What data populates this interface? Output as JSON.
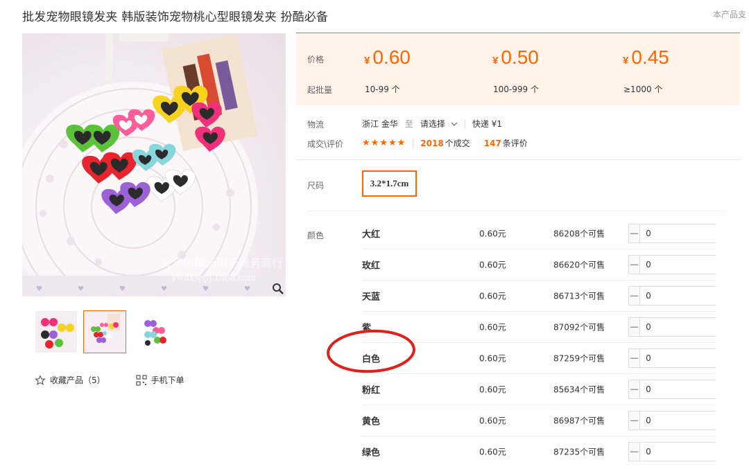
{
  "product": {
    "title": "批发宠物眼镜发夹 韩版装饰宠物桃心型眼镜发夹 扮酷必备",
    "report_link": "本产品支"
  },
  "gallery": {
    "watermark_line1": "义乌市酷玩电子商务商行",
    "watermark_line2": "ywdxsppj.1688.com",
    "zoom_icon": "magnifier-icon",
    "thumbnails": [
      "thumb-1",
      "thumb-2",
      "thumb-3"
    ],
    "active_thumbnail": 1
  },
  "actions": {
    "favorite_label": "收藏产品（5）",
    "favorite_icon": "star-outline-icon",
    "mobile_label": "手机下单",
    "mobile_icon": "qrcode-icon"
  },
  "pricing": {
    "price_label": "价格",
    "moq_label": "起批量",
    "currency": "¥",
    "tiers": [
      {
        "price": "0.60",
        "qty": "10-99 个"
      },
      {
        "price": "0.50",
        "qty": "100-999 个"
      },
      {
        "price": "0.45",
        "qty": "≥1000 个"
      }
    ],
    "accent_color": "#ff6600"
  },
  "logistics": {
    "label": "物流",
    "origin": "浙江 金华",
    "to": "至",
    "destination": "请选择",
    "shipping": "快递 ¥1"
  },
  "deals": {
    "label": "成交\\评价",
    "stars": "★★★★★",
    "deals_count": "2018",
    "deals_suffix": "个成交",
    "reviews_count": "147",
    "reviews_suffix": "条评价"
  },
  "size": {
    "label": "尺码",
    "value": "3.2*1.7cm"
  },
  "colors": {
    "label": "颜色",
    "items": [
      {
        "name": "大红",
        "price": "0.60元",
        "stock": "86208个可售",
        "qty": "0"
      },
      {
        "name": "玫红",
        "price": "0.60元",
        "stock": "86620个可售",
        "qty": "0"
      },
      {
        "name": "天蓝",
        "price": "0.60元",
        "stock": "86713个可售",
        "qty": "0"
      },
      {
        "name": "紫",
        "price": "0.60元",
        "stock": "87092个可售",
        "qty": "0"
      },
      {
        "name": "白色",
        "price": "0.60元",
        "stock": "87259个可售",
        "qty": "0"
      },
      {
        "name": "粉红",
        "price": "0.60元",
        "stock": "85634个可售",
        "qty": "0"
      },
      {
        "name": "黄色",
        "price": "0.60元",
        "stock": "86987个可售",
        "qty": "0"
      },
      {
        "name": "绿色",
        "price": "0.60元",
        "stock": "87235个可售",
        "qty": "0"
      }
    ]
  },
  "annotation": {
    "color": "#e0201b"
  }
}
